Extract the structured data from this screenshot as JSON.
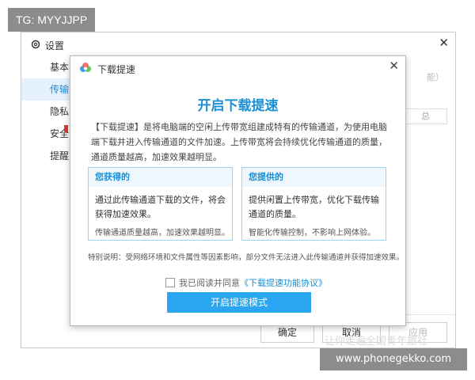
{
  "badge": {
    "text": "TG: MYYJJPP"
  },
  "settings": {
    "title": "设置",
    "close": "✕",
    "sidebar": [
      {
        "label": "基本"
      },
      {
        "label": "传输"
      },
      {
        "label": "隐私"
      },
      {
        "label": "安全"
      },
      {
        "label": "提醒"
      }
    ],
    "right_hint": "能）",
    "right_box": "总",
    "buttons": {
      "ok": "确定",
      "cancel": "取消",
      "apply": "应用"
    }
  },
  "dialog": {
    "title": "下载提速",
    "close": "✕",
    "heading": "开启下载提速",
    "intro": "【下载提速】是将电脑端的空闲上传带宽组建成特有的传输通道，为使用电脑端下载并进入传输通道的文件加速。上传带宽将会持续优化传输通道的质量，通道质量越高，加速效果越明显。",
    "cards": [
      {
        "title": "您获得的",
        "body": "通过此传输通道下载的文件，将会获得加速效果。",
        "note": "传输通道质量越高，加速效果越明显。"
      },
      {
        "title": "您提供的",
        "body": "提供闲置上传带宽，优化下载传输通道的质量。",
        "note": "智能化传输控制，不影响上网体验。"
      }
    ],
    "note": "特别说明：受网络环境和文件属性等因素影响，部分文件无法进入此传输通道并获得加速效果。",
    "agree_prefix": "我已阅读并同意",
    "agree_link": "《下载提速功能协议》",
    "primary_button": "开启提速模式"
  },
  "watermark": {
    "text": "让你走遍全国青年旅社",
    "site": "www.phonegekko.com"
  },
  "colors": {
    "accent": "#1a8fd4",
    "button": "#2aa6f1",
    "card_border": "#9fd3f4"
  }
}
